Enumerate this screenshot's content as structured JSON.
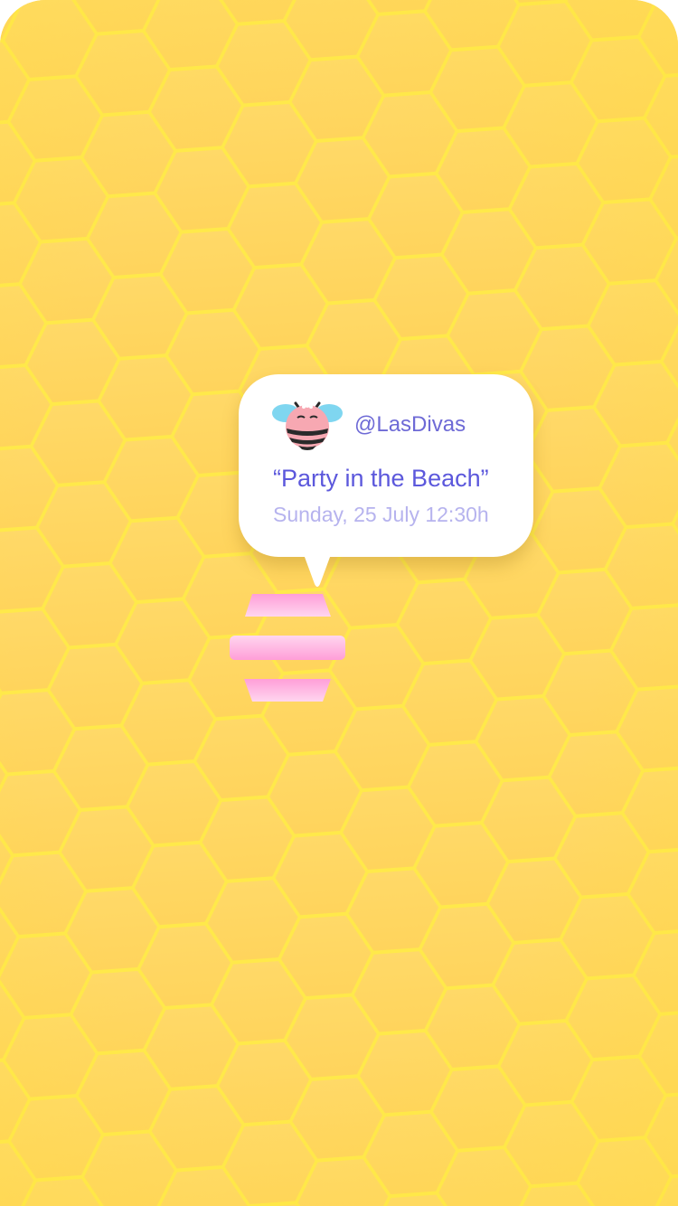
{
  "post": {
    "username": "@LasDivas",
    "title": "“Party in the Beach”",
    "datetime": "Sunday, 25 July 12:30h",
    "avatar_icon": "pink-bee-icon"
  },
  "hive_icon": "beehive-icon",
  "colors": {
    "background": "#ffd85a",
    "comb_edge": "#ffe94a",
    "bubble": "#ffffff",
    "username": "#6e6ad6",
    "title": "#5c58dc",
    "date": "#b6b3ee",
    "hive_pink": "#ff9ed8",
    "bee_pink": "#f7a8b2",
    "bee_wing": "#7fd6f0"
  }
}
